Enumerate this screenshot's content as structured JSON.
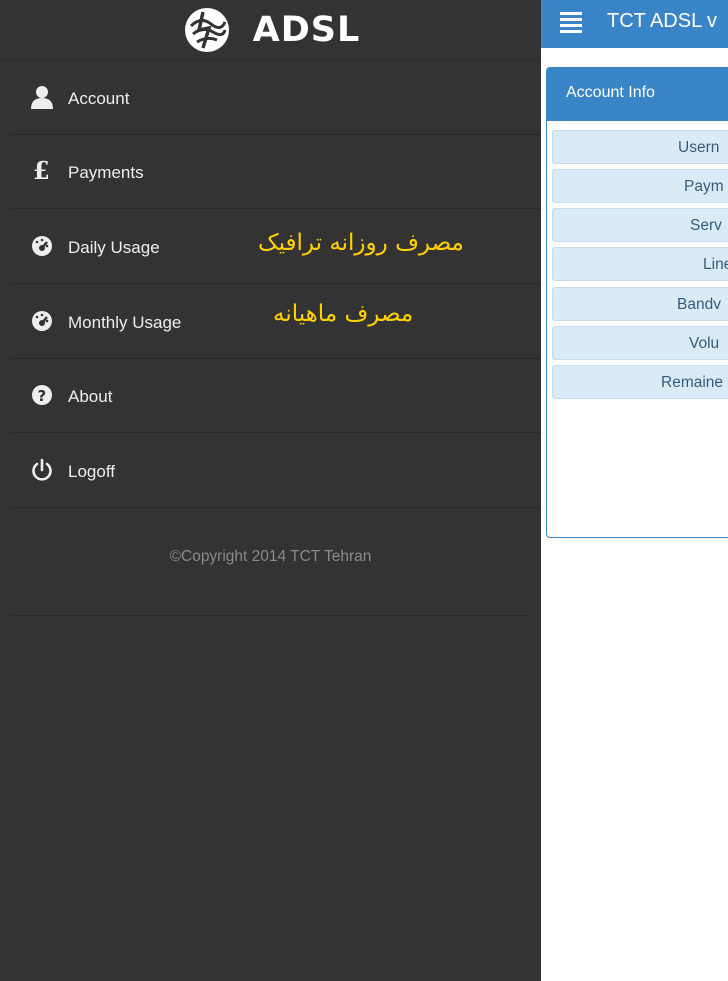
{
  "drawer": {
    "brand_name": "ADSL",
    "menu": [
      {
        "label": "Account",
        "icon": "user-icon"
      },
      {
        "label": "Payments",
        "icon": "pound-icon"
      },
      {
        "label": "Daily Usage",
        "icon": "gauge-icon"
      },
      {
        "label": "Monthly Usage",
        "icon": "gauge-icon"
      },
      {
        "label": "About",
        "icon": "question-icon"
      },
      {
        "label": "Logoff",
        "icon": "power-icon"
      }
    ],
    "annotations": {
      "daily": "مصرف روزانه ترافیک",
      "monthly": "مصرف ماهیانه"
    },
    "copyright": "©Copyright 2014 TCT Tehran"
  },
  "main": {
    "appbar_title": "TCT ADSL v",
    "card_title": "Account Info",
    "fields": [
      "Usern",
      "Paym",
      "Serv",
      "Line",
      "Bandv",
      "Volu",
      "Remaine"
    ]
  },
  "colors": {
    "drawer_bg": "#333333",
    "accent_blue": "#3a84c8",
    "annotation_yellow": "#ffd200",
    "field_bg": "#d9ebf7"
  }
}
